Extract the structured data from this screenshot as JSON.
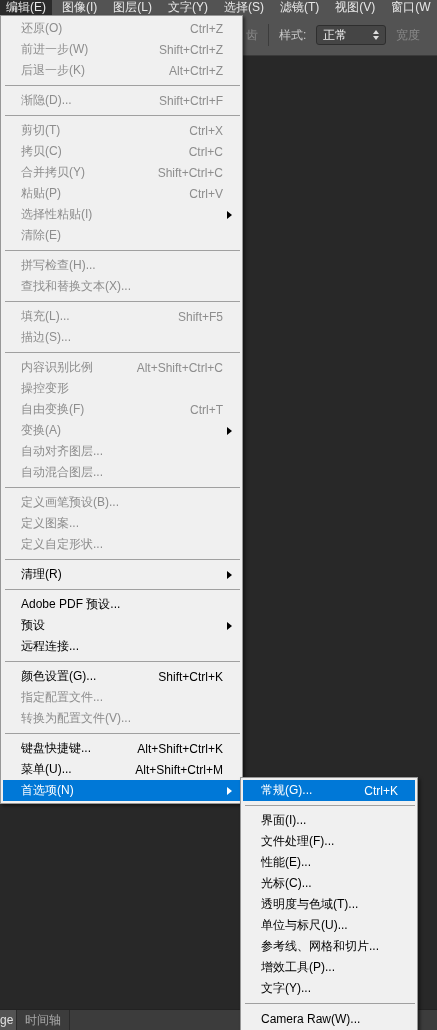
{
  "menu_bar": [
    {
      "label": "编辑(E)",
      "selected": true
    },
    {
      "label": "图像(I)",
      "selected": false
    },
    {
      "label": "图层(L)",
      "selected": false
    },
    {
      "label": "文字(Y)",
      "selected": false
    },
    {
      "label": "选择(S)",
      "selected": false
    },
    {
      "label": "滤镜(T)",
      "selected": false
    },
    {
      "label": "视图(V)",
      "selected": false
    },
    {
      "label": "窗口(W",
      "selected": false
    }
  ],
  "options_bar": {
    "partial_label": "齿",
    "style_label": "样式:",
    "style_value": "正常",
    "width_label": "宽度"
  },
  "edit_menu": [
    {
      "kind": "item",
      "label": "还原(O)",
      "shortcut": "Ctrl+Z",
      "disabled": true,
      "has_submenu": false,
      "selected": false
    },
    {
      "kind": "item",
      "label": "前进一步(W)",
      "shortcut": "Shift+Ctrl+Z",
      "disabled": true,
      "has_submenu": false,
      "selected": false
    },
    {
      "kind": "item",
      "label": "后退一步(K)",
      "shortcut": "Alt+Ctrl+Z",
      "disabled": true,
      "has_submenu": false,
      "selected": false
    },
    {
      "kind": "separator"
    },
    {
      "kind": "item",
      "label": "渐隐(D)...",
      "shortcut": "Shift+Ctrl+F",
      "disabled": true,
      "has_submenu": false,
      "selected": false
    },
    {
      "kind": "separator"
    },
    {
      "kind": "item",
      "label": "剪切(T)",
      "shortcut": "Ctrl+X",
      "disabled": true,
      "has_submenu": false,
      "selected": false
    },
    {
      "kind": "item",
      "label": "拷贝(C)",
      "shortcut": "Ctrl+C",
      "disabled": true,
      "has_submenu": false,
      "selected": false
    },
    {
      "kind": "item",
      "label": "合并拷贝(Y)",
      "shortcut": "Shift+Ctrl+C",
      "disabled": true,
      "has_submenu": false,
      "selected": false
    },
    {
      "kind": "item",
      "label": "粘贴(P)",
      "shortcut": "Ctrl+V",
      "disabled": true,
      "has_submenu": false,
      "selected": false
    },
    {
      "kind": "item",
      "label": "选择性粘贴(I)",
      "disabled": true,
      "has_submenu": true,
      "selected": false
    },
    {
      "kind": "item",
      "label": "清除(E)",
      "disabled": true,
      "has_submenu": false,
      "selected": false
    },
    {
      "kind": "separator"
    },
    {
      "kind": "item",
      "label": "拼写检查(H)...",
      "disabled": true,
      "has_submenu": false,
      "selected": false
    },
    {
      "kind": "item",
      "label": "查找和替换文本(X)...",
      "disabled": true,
      "has_submenu": false,
      "selected": false
    },
    {
      "kind": "separator"
    },
    {
      "kind": "item",
      "label": "填充(L)...",
      "shortcut": "Shift+F5",
      "disabled": true,
      "has_submenu": false,
      "selected": false
    },
    {
      "kind": "item",
      "label": "描边(S)...",
      "disabled": true,
      "has_submenu": false,
      "selected": false
    },
    {
      "kind": "separator"
    },
    {
      "kind": "item",
      "label": "内容识别比例",
      "shortcut": "Alt+Shift+Ctrl+C",
      "disabled": true,
      "has_submenu": false,
      "selected": false
    },
    {
      "kind": "item",
      "label": "操控变形",
      "disabled": true,
      "has_submenu": false,
      "selected": false
    },
    {
      "kind": "item",
      "label": "自由变换(F)",
      "shortcut": "Ctrl+T",
      "disabled": true,
      "has_submenu": false,
      "selected": false
    },
    {
      "kind": "item",
      "label": "变换(A)",
      "disabled": true,
      "has_submenu": true,
      "selected": false
    },
    {
      "kind": "item",
      "label": "自动对齐图层...",
      "disabled": true,
      "has_submenu": false,
      "selected": false
    },
    {
      "kind": "item",
      "label": "自动混合图层...",
      "disabled": true,
      "has_submenu": false,
      "selected": false
    },
    {
      "kind": "separator"
    },
    {
      "kind": "item",
      "label": "定义画笔预设(B)...",
      "disabled": true,
      "has_submenu": false,
      "selected": false
    },
    {
      "kind": "item",
      "label": "定义图案...",
      "disabled": true,
      "has_submenu": false,
      "selected": false
    },
    {
      "kind": "item",
      "label": "定义自定形状...",
      "disabled": true,
      "has_submenu": false,
      "selected": false
    },
    {
      "kind": "separator"
    },
    {
      "kind": "item",
      "label": "清理(R)",
      "disabled": false,
      "has_submenu": true,
      "selected": false
    },
    {
      "kind": "separator"
    },
    {
      "kind": "item",
      "label": "Adobe PDF 预设...",
      "disabled": false,
      "has_submenu": false,
      "selected": false
    },
    {
      "kind": "item",
      "label": "预设",
      "disabled": false,
      "has_submenu": true,
      "selected": false
    },
    {
      "kind": "item",
      "label": "远程连接...",
      "disabled": false,
      "has_submenu": false,
      "selected": false
    },
    {
      "kind": "separator"
    },
    {
      "kind": "item",
      "label": "颜色设置(G)...",
      "shortcut": "Shift+Ctrl+K",
      "disabled": false,
      "has_submenu": false,
      "selected": false
    },
    {
      "kind": "item",
      "label": "指定配置文件...",
      "disabled": true,
      "has_submenu": false,
      "selected": false
    },
    {
      "kind": "item",
      "label": "转换为配置文件(V)...",
      "disabled": true,
      "has_submenu": false,
      "selected": false
    },
    {
      "kind": "separator"
    },
    {
      "kind": "item",
      "label": "键盘快捷键...",
      "shortcut": "Alt+Shift+Ctrl+K",
      "disabled": false,
      "has_submenu": false,
      "selected": false
    },
    {
      "kind": "item",
      "label": "菜单(U)...",
      "shortcut": "Alt+Shift+Ctrl+M",
      "disabled": false,
      "has_submenu": false,
      "selected": false
    },
    {
      "kind": "item",
      "label": "首选项(N)",
      "disabled": false,
      "has_submenu": true,
      "selected": true
    }
  ],
  "preferences_submenu": [
    {
      "kind": "item",
      "label": "常规(G)...",
      "shortcut": "Ctrl+K",
      "disabled": false,
      "has_submenu": false,
      "selected": true
    },
    {
      "kind": "separator"
    },
    {
      "kind": "item",
      "label": "界面(I)...",
      "disabled": false,
      "has_submenu": false,
      "selected": false
    },
    {
      "kind": "item",
      "label": "文件处理(F)...",
      "disabled": false,
      "has_submenu": false,
      "selected": false
    },
    {
      "kind": "item",
      "label": "性能(E)...",
      "disabled": false,
      "has_submenu": false,
      "selected": false
    },
    {
      "kind": "item",
      "label": "光标(C)...",
      "disabled": false,
      "has_submenu": false,
      "selected": false
    },
    {
      "kind": "item",
      "label": "透明度与色域(T)...",
      "disabled": false,
      "has_submenu": false,
      "selected": false
    },
    {
      "kind": "item",
      "label": "单位与标尺(U)...",
      "disabled": false,
      "has_submenu": false,
      "selected": false
    },
    {
      "kind": "item",
      "label": "参考线、网格和切片...",
      "disabled": false,
      "has_submenu": false,
      "selected": false
    },
    {
      "kind": "item",
      "label": "增效工具(P)...",
      "disabled": false,
      "has_submenu": false,
      "selected": false
    },
    {
      "kind": "item",
      "label": "文字(Y)...",
      "disabled": false,
      "has_submenu": false,
      "selected": false
    },
    {
      "kind": "separator"
    },
    {
      "kind": "item",
      "label": "Camera Raw(W)...",
      "disabled": false,
      "has_submenu": false,
      "selected": false
    }
  ],
  "bottom_tabs": [
    {
      "label": "ge",
      "selected": true
    },
    {
      "label": "时间轴",
      "selected": false
    }
  ]
}
